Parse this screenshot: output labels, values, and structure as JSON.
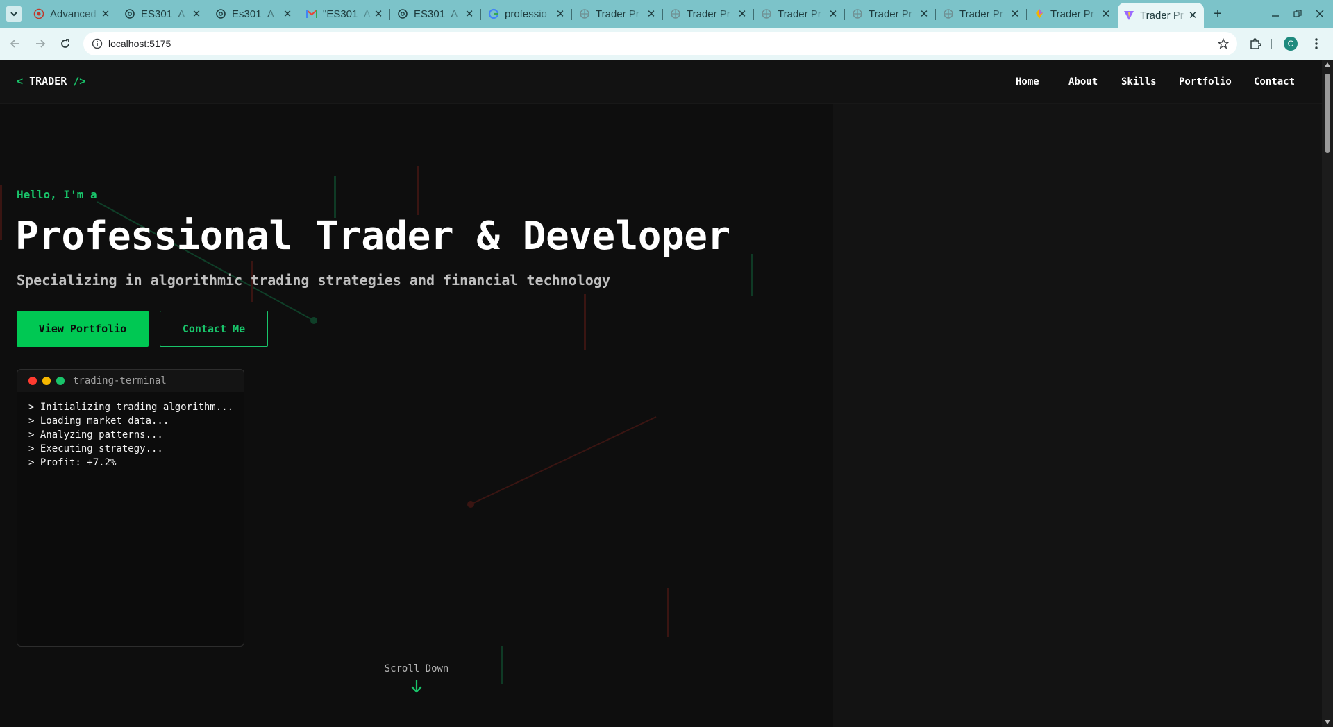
{
  "browser": {
    "tabs": [
      {
        "title": "Advanced",
        "icon": "globe-icon"
      },
      {
        "title": "ES301_A",
        "icon": "openai-icon"
      },
      {
        "title": "Es301_A",
        "icon": "openai-icon"
      },
      {
        "title": "\"ES301_A",
        "icon": "gmail-icon"
      },
      {
        "title": "ES301_A",
        "icon": "openai-icon"
      },
      {
        "title": "professio",
        "icon": "google-icon"
      },
      {
        "title": "Trader Pr",
        "icon": "globe-icon"
      },
      {
        "title": "Trader Pr",
        "icon": "globe-icon"
      },
      {
        "title": "Trader Pr",
        "icon": "globe-icon"
      },
      {
        "title": "Trader Pr",
        "icon": "globe-icon"
      },
      {
        "title": "Trader Pr",
        "icon": "globe-icon"
      },
      {
        "title": "Trader Pr",
        "icon": "bulb-icon"
      },
      {
        "title": "Trader Pr",
        "icon": "vite-icon",
        "active": true
      }
    ],
    "url": "localhost:5175",
    "profile_initial": "C"
  },
  "site": {
    "logo": {
      "open": "<",
      "name": "TRADER",
      "close": "/>"
    },
    "nav": [
      "Home",
      "About",
      "Skills",
      "Portfolio",
      "Contact"
    ]
  },
  "hero": {
    "greeting": "Hello, I'm a",
    "title": "Professional Trader & Developer",
    "subtitle": "Specializing in algorithmic trading strategies and financial technology",
    "primary_button": "View Portfolio",
    "secondary_button": "Contact Me"
  },
  "terminal": {
    "title": "trading-terminal",
    "lines": [
      "> Initializing trading algorithm...",
      "> Loading market data...",
      "> Analyzing patterns...",
      "> Executing strategy...",
      "> Profit: +7.2%"
    ]
  },
  "scroll_hint": "Scroll Down",
  "colors": {
    "accent": "#00c853",
    "background": "#0e0e0e",
    "dot_red": "#ff3b30",
    "dot_yellow": "#f5b700",
    "dot_green": "#19c46a"
  }
}
